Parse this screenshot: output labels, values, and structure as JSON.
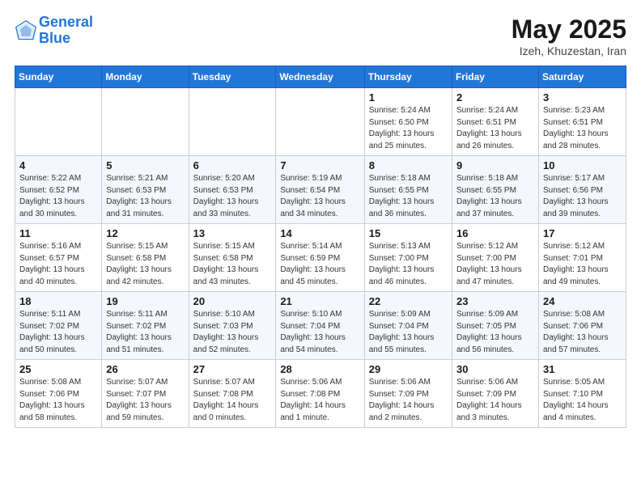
{
  "header": {
    "logo_line1": "General",
    "logo_line2": "Blue",
    "title": "May 2025",
    "location": "Izeh, Khuzestan, Iran"
  },
  "weekdays": [
    "Sunday",
    "Monday",
    "Tuesday",
    "Wednesday",
    "Thursday",
    "Friday",
    "Saturday"
  ],
  "weeks": [
    [
      {
        "day": "",
        "info": ""
      },
      {
        "day": "",
        "info": ""
      },
      {
        "day": "",
        "info": ""
      },
      {
        "day": "",
        "info": ""
      },
      {
        "day": "1",
        "info": "Sunrise: 5:24 AM\nSunset: 6:50 PM\nDaylight: 13 hours\nand 25 minutes."
      },
      {
        "day": "2",
        "info": "Sunrise: 5:24 AM\nSunset: 6:51 PM\nDaylight: 13 hours\nand 26 minutes."
      },
      {
        "day": "3",
        "info": "Sunrise: 5:23 AM\nSunset: 6:51 PM\nDaylight: 13 hours\nand 28 minutes."
      }
    ],
    [
      {
        "day": "4",
        "info": "Sunrise: 5:22 AM\nSunset: 6:52 PM\nDaylight: 13 hours\nand 30 minutes."
      },
      {
        "day": "5",
        "info": "Sunrise: 5:21 AM\nSunset: 6:53 PM\nDaylight: 13 hours\nand 31 minutes."
      },
      {
        "day": "6",
        "info": "Sunrise: 5:20 AM\nSunset: 6:53 PM\nDaylight: 13 hours\nand 33 minutes."
      },
      {
        "day": "7",
        "info": "Sunrise: 5:19 AM\nSunset: 6:54 PM\nDaylight: 13 hours\nand 34 minutes."
      },
      {
        "day": "8",
        "info": "Sunrise: 5:18 AM\nSunset: 6:55 PM\nDaylight: 13 hours\nand 36 minutes."
      },
      {
        "day": "9",
        "info": "Sunrise: 5:18 AM\nSunset: 6:55 PM\nDaylight: 13 hours\nand 37 minutes."
      },
      {
        "day": "10",
        "info": "Sunrise: 5:17 AM\nSunset: 6:56 PM\nDaylight: 13 hours\nand 39 minutes."
      }
    ],
    [
      {
        "day": "11",
        "info": "Sunrise: 5:16 AM\nSunset: 6:57 PM\nDaylight: 13 hours\nand 40 minutes."
      },
      {
        "day": "12",
        "info": "Sunrise: 5:15 AM\nSunset: 6:58 PM\nDaylight: 13 hours\nand 42 minutes."
      },
      {
        "day": "13",
        "info": "Sunrise: 5:15 AM\nSunset: 6:58 PM\nDaylight: 13 hours\nand 43 minutes."
      },
      {
        "day": "14",
        "info": "Sunrise: 5:14 AM\nSunset: 6:59 PM\nDaylight: 13 hours\nand 45 minutes."
      },
      {
        "day": "15",
        "info": "Sunrise: 5:13 AM\nSunset: 7:00 PM\nDaylight: 13 hours\nand 46 minutes."
      },
      {
        "day": "16",
        "info": "Sunrise: 5:12 AM\nSunset: 7:00 PM\nDaylight: 13 hours\nand 47 minutes."
      },
      {
        "day": "17",
        "info": "Sunrise: 5:12 AM\nSunset: 7:01 PM\nDaylight: 13 hours\nand 49 minutes."
      }
    ],
    [
      {
        "day": "18",
        "info": "Sunrise: 5:11 AM\nSunset: 7:02 PM\nDaylight: 13 hours\nand 50 minutes."
      },
      {
        "day": "19",
        "info": "Sunrise: 5:11 AM\nSunset: 7:02 PM\nDaylight: 13 hours\nand 51 minutes."
      },
      {
        "day": "20",
        "info": "Sunrise: 5:10 AM\nSunset: 7:03 PM\nDaylight: 13 hours\nand 52 minutes."
      },
      {
        "day": "21",
        "info": "Sunrise: 5:10 AM\nSunset: 7:04 PM\nDaylight: 13 hours\nand 54 minutes."
      },
      {
        "day": "22",
        "info": "Sunrise: 5:09 AM\nSunset: 7:04 PM\nDaylight: 13 hours\nand 55 minutes."
      },
      {
        "day": "23",
        "info": "Sunrise: 5:09 AM\nSunset: 7:05 PM\nDaylight: 13 hours\nand 56 minutes."
      },
      {
        "day": "24",
        "info": "Sunrise: 5:08 AM\nSunset: 7:06 PM\nDaylight: 13 hours\nand 57 minutes."
      }
    ],
    [
      {
        "day": "25",
        "info": "Sunrise: 5:08 AM\nSunset: 7:06 PM\nDaylight: 13 hours\nand 58 minutes."
      },
      {
        "day": "26",
        "info": "Sunrise: 5:07 AM\nSunset: 7:07 PM\nDaylight: 13 hours\nand 59 minutes."
      },
      {
        "day": "27",
        "info": "Sunrise: 5:07 AM\nSunset: 7:08 PM\nDaylight: 14 hours\nand 0 minutes."
      },
      {
        "day": "28",
        "info": "Sunrise: 5:06 AM\nSunset: 7:08 PM\nDaylight: 14 hours\nand 1 minute."
      },
      {
        "day": "29",
        "info": "Sunrise: 5:06 AM\nSunset: 7:09 PM\nDaylight: 14 hours\nand 2 minutes."
      },
      {
        "day": "30",
        "info": "Sunrise: 5:06 AM\nSunset: 7:09 PM\nDaylight: 14 hours\nand 3 minutes."
      },
      {
        "day": "31",
        "info": "Sunrise: 5:05 AM\nSunset: 7:10 PM\nDaylight: 14 hours\nand 4 minutes."
      }
    ]
  ]
}
